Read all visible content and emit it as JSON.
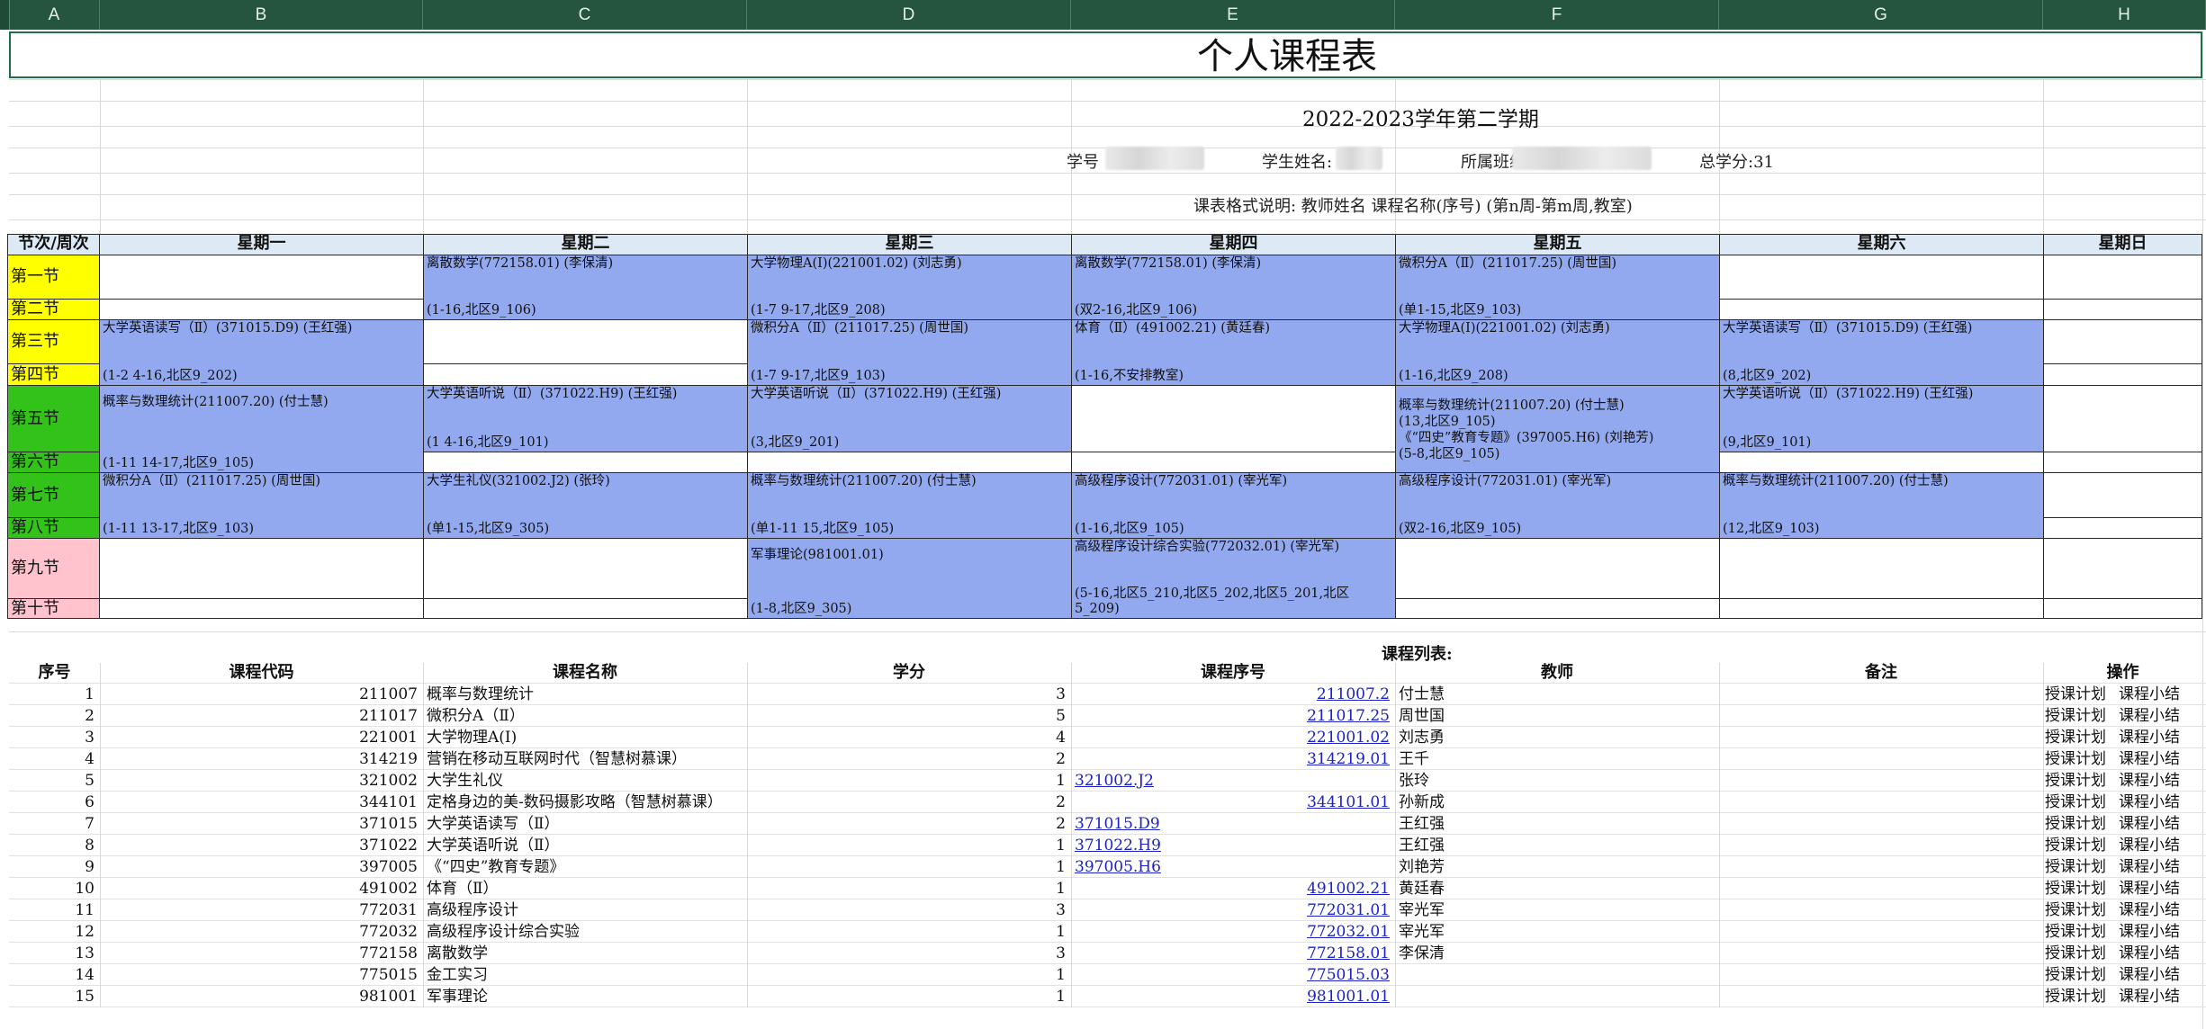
{
  "columns": [
    "A",
    "B",
    "C",
    "D",
    "E",
    "F",
    "G",
    "H"
  ],
  "title": "个人课程表",
  "subtitle": "2022-2023学年第二学期",
  "info": {
    "student_id_label": "学号",
    "student_name_label": "学生姓名:",
    "class_label": "所属班级:",
    "total_credits": "总学分:31"
  },
  "note": "课表格式说明: 教师姓名 课程名称(序号) (第n周-第m周,教室)",
  "schedule": {
    "corner": "节次/周次",
    "days": [
      "星期一",
      "星期二",
      "星期三",
      "星期四",
      "星期五",
      "星期六",
      "星期日"
    ],
    "periods": [
      "第一节",
      "第二节",
      "第三节",
      "第四节",
      "第五节",
      "第六节",
      "第七节",
      "第八节",
      "第九节",
      "第十节"
    ],
    "mon": {
      "p34": {
        "name": "大学英语读写（Ⅱ）(371015.D9)  (王红强)",
        "time": "(1-2 4-16,北区9_202)"
      },
      "p56": {
        "name": "概率与数理统计(211007.20)  (付士慧)",
        "time": "(1-11 14-17,北区9_105)"
      },
      "p78": {
        "name": "微积分A（Ⅱ）(211017.25)  (周世国)",
        "time": "(1-11 13-17,北区9_103)"
      }
    },
    "tue": {
      "p12": {
        "name": "离散数学(772158.01)  (李保清)",
        "time": "(1-16,北区9_106)"
      },
      "p56": {
        "name": "大学英语听说（Ⅱ）(371022.H9)  (王红强)",
        "time": "(1 4-16,北区9_101)"
      },
      "p78": {
        "name": "大学生礼仪(321002.J2)  (张玲)",
        "time": "(单1-15,北区9_305)"
      }
    },
    "wed": {
      "p12": {
        "name": "大学物理A(Ⅰ)(221001.02)  (刘志勇)",
        "time": "(1-7 9-17,北区9_208)"
      },
      "p34": {
        "name": "微积分A（Ⅱ）(211017.25)  (周世国)",
        "time": "(1-7 9-17,北区9_103)"
      },
      "p56": {
        "name": "大学英语听说（Ⅱ）(371022.H9)  (王红强)",
        "time": "(3,北区9_201)"
      },
      "p78": {
        "name": "概率与数理统计(211007.20)  (付士慧)",
        "time": "(单1-11 15,北区9_105)"
      },
      "p910": {
        "name": "军事理论(981001.01)",
        "time": "(1-8,北区9_305)"
      }
    },
    "thu": {
      "p12": {
        "name": "离散数学(772158.01)  (李保清)",
        "time": "(双2-16,北区9_106)"
      },
      "p34": {
        "name": "体育（Ⅱ）(491002.21)  (黄廷春)",
        "time": "(1-16,不安排教室)"
      },
      "p78": {
        "name": "高级程序设计(772031.01)  (宰光军)",
        "time": "(1-16,北区9_105)"
      },
      "p910": {
        "name": "高级程序设计综合实验(772032.01)  (宰光军)",
        "time": "(5-16,北区5_210,北区5_202,北区5_201,北区5_209)"
      }
    },
    "fri": {
      "p12": {
        "name": "微积分A（Ⅱ）(211017.25)  (周世国)",
        "time": "(单1-15,北区9_103)"
      },
      "p34": {
        "name": "大学物理A(Ⅰ)(221001.02)  (刘志勇)",
        "time": "(1-16,北区9_208)"
      },
      "p56": {
        "l1": "概率与数理统计(211007.20)  (付士慧)",
        "l2": "(13,北区9_105)",
        "l3": "《“四史”教育专题》(397005.H6)  (刘艳芳)",
        "l4": "(5-8,北区9_105)"
      },
      "p78": {
        "name": "高级程序设计(772031.01)  (宰光军)",
        "time": "(双2-16,北区9_105)"
      }
    },
    "sat": {
      "p34": {
        "name": "大学英语读写（Ⅱ）(371015.D9)  (王红强)",
        "time": "(8,北区9_202)"
      },
      "p56": {
        "name": "大学英语听说（Ⅱ）(371022.H9)  (王红强)",
        "time": "(9,北区9_101)"
      },
      "p78": {
        "name": "概率与数理统计(211007.20)  (付士慧)",
        "time": "(12,北区9_103)"
      }
    }
  },
  "course_list": {
    "title": "课程列表:",
    "headers": [
      "序号",
      "课程代码",
      "课程名称",
      "学分",
      "课程序号",
      "教师",
      "备注",
      "操作"
    ],
    "action_plan": "授课计划",
    "action_summary": "课程小结",
    "rows": [
      {
        "no": "1",
        "code": "211007",
        "name": "概率与数理统计",
        "credit": "3",
        "seq": "211007.2",
        "teacher": "付士慧",
        "align": "right"
      },
      {
        "no": "2",
        "code": "211017",
        "name": "微积分A（Ⅱ）",
        "credit": "5",
        "seq": "211017.25",
        "teacher": "周世国",
        "align": "right"
      },
      {
        "no": "3",
        "code": "221001",
        "name": "大学物理A(Ⅰ)",
        "credit": "4",
        "seq": "221001.02",
        "teacher": "刘志勇",
        "align": "right"
      },
      {
        "no": "4",
        "code": "314219",
        "name": "营销在移动互联网时代（智慧树慕课）",
        "credit": "2",
        "seq": "314219.01",
        "teacher": "王千",
        "align": "right"
      },
      {
        "no": "5",
        "code": "321002",
        "name": "大学生礼仪",
        "credit": "1",
        "seq": "321002.J2",
        "teacher": "张玲",
        "align": "left"
      },
      {
        "no": "6",
        "code": "344101",
        "name": "定格身边的美-数码摄影攻略（智慧树慕课）",
        "credit": "2",
        "seq": "344101.01",
        "teacher": "孙新成",
        "align": "right"
      },
      {
        "no": "7",
        "code": "371015",
        "name": "大学英语读写（Ⅱ）",
        "credit": "2",
        "seq": "371015.D9",
        "teacher": "王红强",
        "align": "left"
      },
      {
        "no": "8",
        "code": "371022",
        "name": "大学英语听说（Ⅱ）",
        "credit": "1",
        "seq": "371022.H9",
        "teacher": "王红强",
        "align": "left"
      },
      {
        "no": "9",
        "code": "397005",
        "name": "《“四史”教育专题》",
        "credit": "1",
        "seq": "397005.H6",
        "teacher": "刘艳芳",
        "align": "left"
      },
      {
        "no": "10",
        "code": "491002",
        "name": "体育（Ⅱ）",
        "credit": "1",
        "seq": "491002.21",
        "teacher": "黄廷春",
        "align": "right"
      },
      {
        "no": "11",
        "code": "772031",
        "name": "高级程序设计",
        "credit": "3",
        "seq": "772031.01",
        "teacher": "宰光军",
        "align": "right"
      },
      {
        "no": "12",
        "code": "772032",
        "name": "高级程序设计综合实验",
        "credit": "1",
        "seq": "772032.01",
        "teacher": "宰光军",
        "align": "right"
      },
      {
        "no": "13",
        "code": "772158",
        "name": "离散数学",
        "credit": "3",
        "seq": "772158.01",
        "teacher": "李保清",
        "align": "right"
      },
      {
        "no": "14",
        "code": "775015",
        "name": "金工实习",
        "credit": "1",
        "seq": "775015.03",
        "teacher": "",
        "align": "right"
      },
      {
        "no": "15",
        "code": "981001",
        "name": "军事理论",
        "credit": "1",
        "seq": "981001.01",
        "teacher": "",
        "align": "right"
      }
    ]
  }
}
